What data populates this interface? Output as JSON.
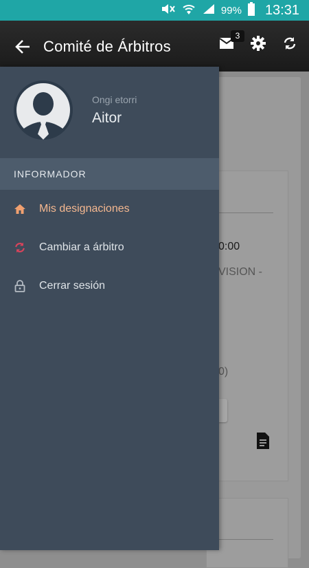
{
  "status_bar": {
    "battery_percent": "99%",
    "time": "13:31",
    "color": "#1fa6a6"
  },
  "toolbar": {
    "title": "Comité de Árbitros",
    "mail_badge": "3"
  },
  "background_content": {
    "time_text": "0:00",
    "division_text": "VISION -",
    "paren_text": "0)"
  },
  "drawer": {
    "greeting": "Ongi etorri",
    "username": "Aitor",
    "section_header": "INFORMADOR",
    "items": [
      {
        "label": "Mis designaciones",
        "icon": "home-icon",
        "active": true
      },
      {
        "label": "Cambiar a árbitro",
        "icon": "sync-icon",
        "active": false
      },
      {
        "label": "Cerrar sesión",
        "icon": "lock-icon",
        "active": false
      }
    ],
    "colors": {
      "background": "#3e4b5a",
      "section": "#4d5c6c",
      "active_text": "#f5b890",
      "active_icon": "#f0a070",
      "sync_icon": "#d9435b"
    }
  }
}
